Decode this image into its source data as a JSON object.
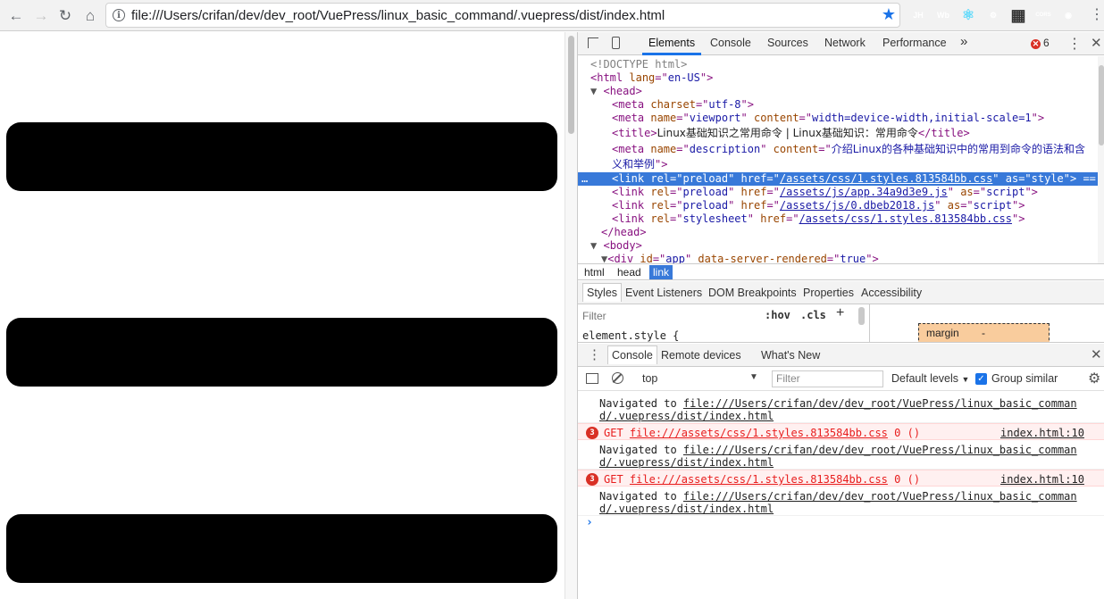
{
  "browser": {
    "url": "file:///Users/crifan/dev/dev_root/VuePress/linux_basic_command/.vuepress/dist/index.html",
    "extensions": [
      {
        "name": "jh-extension-icon",
        "label": "JH",
        "color": "#3b78e7"
      },
      {
        "name": "wb-extension-icon",
        "label": "Wb",
        "color": "#6a5acd"
      },
      {
        "name": "react-devtools-icon",
        "label": "⚛",
        "color": "#61dafb"
      },
      {
        "name": "orange-extension-icon",
        "label": "⚙",
        "color": "#f39c12"
      },
      {
        "name": "qr-code-icon",
        "label": "▦",
        "color": "#333333"
      },
      {
        "name": "cors-extension-icon",
        "label": "CORS",
        "color": "#2e9d57"
      },
      {
        "name": "blue-extension-icon",
        "label": "◉",
        "color": "#1e88e5"
      }
    ]
  },
  "devtools": {
    "tabs": [
      "Elements",
      "Console",
      "Sources",
      "Network",
      "Performance"
    ],
    "more_tabs": "»",
    "error_count": "6",
    "dom": {
      "doctype": "<!DOCTYPE html>",
      "html_open": {
        "tag": "html",
        "attr": "lang",
        "value": "en-US"
      },
      "head": "head",
      "meta_charset": {
        "attr": "charset",
        "value": "utf-8"
      },
      "meta_viewport": {
        "name": "viewport",
        "content": "width=device-width,initial-scale=1"
      },
      "title": "Linux基础知识之常用命令 | Linux基础知识：常用命令",
      "meta_desc_name": "description",
      "meta_desc_content_1": "介绍Linux的各种基础知识中的常用到命令的语法和含",
      "meta_desc_content_2": "义和举例",
      "links": [
        {
          "rel": "preload",
          "href": "/assets/css/1.styles.813584bb.css",
          "as": "style"
        },
        {
          "rel": "preload",
          "href": "/assets/js/app.34a9d3e9.js",
          "as": "script"
        },
        {
          "rel": "preload",
          "href": "/assets/js/0.dbeb2018.js",
          "as": "script"
        },
        {
          "rel": "stylesheet",
          "href": "/assets/css/1.styles.813584bb.css"
        }
      ],
      "selected_suffix": " == $0",
      "body": "body",
      "div_app": {
        "id": "app",
        "attr": "data-server-rendered",
        "value": "true"
      }
    },
    "breadcrumbs": [
      "html",
      "head",
      "link"
    ],
    "sub_tabs": [
      "Styles",
      "Event Listeners",
      "DOM Breakpoints",
      "Properties",
      "Accessibility"
    ],
    "styles": {
      "filter_placeholder": "Filter",
      "hov": ":hov",
      "cls": ".cls",
      "element_style": "element.style {",
      "margin_label": "margin",
      "margin_value": "-"
    },
    "drawer_tabs": [
      "Console",
      "Remote devices",
      "What's New"
    ],
    "console": {
      "context": "top",
      "filter_placeholder": "Filter",
      "levels": "Default levels",
      "group_similar": "Group similar",
      "messages": [
        {
          "type": "log",
          "prefix": "Navigated to ",
          "line1": "file:///Users/crifan/dev/dev_root/VuePress/linux_basic_comman",
          "line2": "d/.vuepress/dist/index.html"
        },
        {
          "type": "error",
          "badge": "3",
          "method": "GET",
          "url": "file:///assets/css/1.styles.813584bb.css",
          "status": "0 ()",
          "source": "index.html:10"
        },
        {
          "type": "log",
          "prefix": "Navigated to ",
          "line1": "file:///Users/crifan/dev/dev_root/VuePress/linux_basic_comman",
          "line2": "d/.vuepress/dist/index.html"
        },
        {
          "type": "error",
          "badge": "3",
          "method": "GET",
          "url": "file:///assets/css/1.styles.813584bb.css",
          "status": "0 ()",
          "source": "index.html:10"
        },
        {
          "type": "log",
          "prefix": "Navigated to ",
          "line1": "file:///Users/crifan/dev/dev_root/VuePress/linux_basic_comman",
          "line2": "d/.vuepress/dist/index.html"
        }
      ],
      "prompt": "›"
    }
  }
}
